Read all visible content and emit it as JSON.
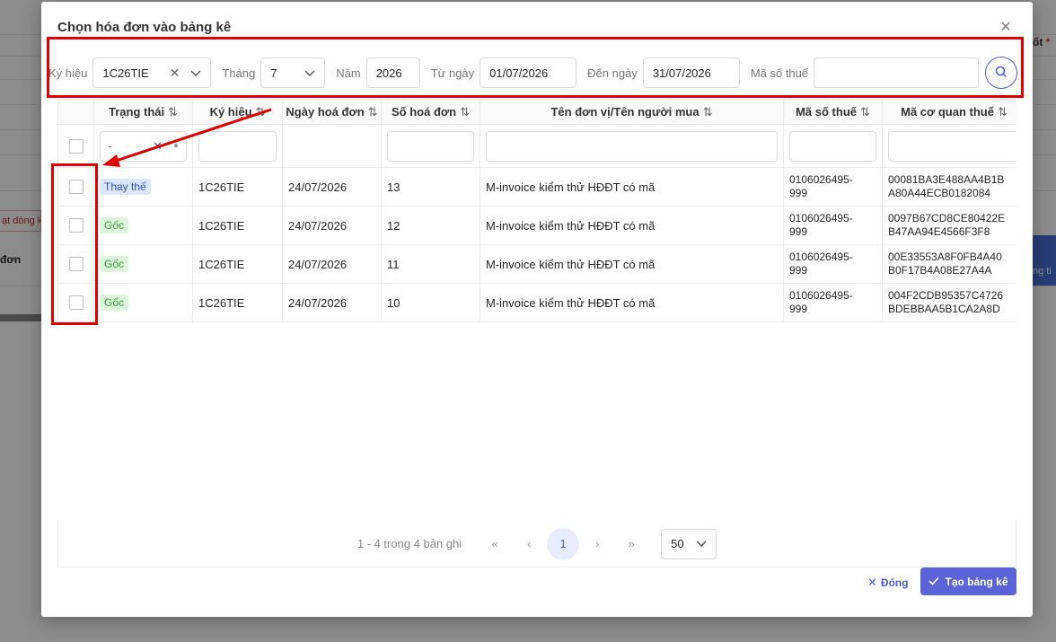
{
  "background": {
    "red_tag": "ạt dòng k",
    "bold_left": "đơn",
    "right_label": "ốt",
    "right_label_star": "*",
    "right_bar": "ng ti"
  },
  "modal": {
    "title": "Chọn hóa đơn vào bảng kê",
    "close_icon": "close-icon"
  },
  "filters": {
    "ky_hieu_label": "Ký hiệu",
    "ky_hieu_value": "1C26TIE",
    "thang_label": "Tháng",
    "thang_value": "7",
    "nam_label": "Năm",
    "nam_value": "2026",
    "tu_ngay_label": "Từ ngày",
    "tu_ngay_value": "01/07/2026",
    "den_ngay_label": "Đến ngày",
    "den_ngay_value": "31/07/2026",
    "ma_so_thue_label": "Mã số thuế",
    "ma_so_thue_value": ""
  },
  "table": {
    "headers": {
      "trang_thai": "Trạng thái",
      "ky_hieu": "Ký hiệu",
      "ngay": "Ngày hoá đơn",
      "so": "Số hoá đơn",
      "ten": "Tên đơn vị/Tên người mua",
      "mst": "Mã số thuế",
      "mcqt": "Mã cơ quan thuế"
    },
    "sort_glyph": "⇅",
    "status_filter_value": "-",
    "rows": [
      {
        "status": "Thay thế",
        "ky_hieu": "1C26TIE",
        "ngay": "24/07/2026",
        "so": "13",
        "ten": "M-invoice kiểm thử HĐĐT có mã",
        "mst_1": "0106026495-",
        "mst_2": "999",
        "mcqt_1": "00081BA3E488AA4B1B",
        "mcqt_2": "A80A44ECB0182084"
      },
      {
        "status": "Gốc",
        "ky_hieu": "1C26TIE",
        "ngay": "24/07/2026",
        "so": "12",
        "ten": "M-invoice kiểm thử HĐĐT có mã",
        "mst_1": "0106026495-",
        "mst_2": "999",
        "mcqt_1": "0097B67CD8CE80422E",
        "mcqt_2": "B47AA94E4566F3F8"
      },
      {
        "status": "Gốc",
        "ky_hieu": "1C26TIE",
        "ngay": "24/07/2026",
        "so": "11",
        "ten": "M-invoice kiểm thử HĐĐT có mã",
        "mst_1": "0106026495-",
        "mst_2": "999",
        "mcqt_1": "00E33553A8F0FB4A40",
        "mcqt_2": "B0F17B4A08E27A4A"
      },
      {
        "status": "Gốc",
        "ky_hieu": "1C26TIE",
        "ngay": "24/07/2026",
        "so": "10",
        "ten": "M-invoice kiểm thử HĐĐT có mã",
        "mst_1": "0106026495-",
        "mst_2": "999",
        "mcqt_1": "004F2CDB95357C4726",
        "mcqt_2": "BDEBBAA5B1CA2A8D"
      }
    ]
  },
  "pagination": {
    "info": "1 - 4 trong 4 bản ghi",
    "first": "«",
    "prev": "‹",
    "current": "1",
    "next": "›",
    "last": "»",
    "page_size": "50"
  },
  "footer": {
    "close_label": "Đóng",
    "create_label": "Tạo bảng kê"
  },
  "colors": {
    "primary": "#5a63d8",
    "annotation": "#e00000"
  }
}
